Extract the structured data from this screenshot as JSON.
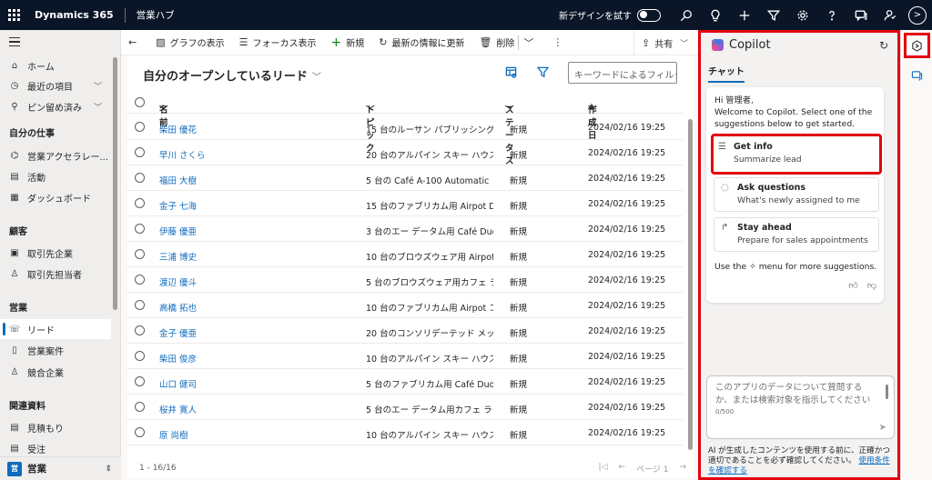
{
  "topbar": {
    "app_title": "Dynamics 365",
    "area": "営業ハブ",
    "new_design": "新デザインを試す",
    "icons": [
      "search-icon",
      "lightbulb-icon",
      "plus-icon",
      "filter-icon",
      "gear-icon",
      "help-icon",
      "chat-icon",
      "people-icon"
    ]
  },
  "sidebar": {
    "home": "ホーム",
    "recent": "最近の項目",
    "pinned": "ピン留め済み",
    "my_work_head": "自分の仕事",
    "my_work": [
      "営業アクセラレー...",
      "活動",
      "ダッシュボード"
    ],
    "customers_head": "顧客",
    "customers": [
      "取引先企業",
      "取引先担当者"
    ],
    "sales_head": "営業",
    "sales": [
      "リード",
      "営業案件",
      "競合企業"
    ],
    "collateral_head": "関連資料",
    "collateral": [
      "見積もり",
      "受注"
    ],
    "area_switch": "営業",
    "area_badge": "営"
  },
  "cmdbar": {
    "show_chart": "グラフの表示",
    "focus_view": "フォーカス表示",
    "new": "新規",
    "refresh": "最新の情報に更新",
    "delete": "削除",
    "share": "共有"
  },
  "view": {
    "title": "自分のオープンしているリード",
    "filter_placeholder": "キーワードによるフィルター",
    "columns": {
      "name": "名前",
      "topic": "トピック",
      "status": "ステータス",
      "created": "作成日"
    },
    "rows": [
      {
        "name": "柴田 優花",
        "topic": "15 台のルーサン パブリッシング用 ...",
        "status": "新規",
        "created": "2024/02/16 19:25"
      },
      {
        "name": "早川 さくら",
        "topic": "20 台のアルパイン スキー ハウス用 ...",
        "status": "新規",
        "created": "2024/02/16 19:25"
      },
      {
        "name": "福田 大樹",
        "topic": "5 台の Café A-100 Automatic",
        "status": "新規",
        "created": "2024/02/16 19:25"
      },
      {
        "name": "金子 七海",
        "topic": "15 台のファブリカム用 Airpot Du...",
        "status": "新規",
        "created": "2024/02/16 19:25"
      },
      {
        "name": "伊藤 優亜",
        "topic": "3 台のエー データム用 Café Duo ...",
        "status": "新規",
        "created": "2024/02/16 19:25"
      },
      {
        "name": "三浦 博史",
        "topic": "10 台のブロウズウェア用 Airpot D...",
        "status": "新規",
        "created": "2024/02/16 19:25"
      },
      {
        "name": "渡辺 優斗",
        "topic": "5 台のブロウズウェア用カフェ ライト ...",
        "status": "新規",
        "created": "2024/02/16 19:25"
      },
      {
        "name": "高橋 拓也",
        "topic": "10 台のファブリカム用 Airpot コー...",
        "status": "新規",
        "created": "2024/02/16 19:25"
      },
      {
        "name": "金子 優亜",
        "topic": "20 台のコンソリデーテッド メッセン...",
        "status": "新規",
        "created": "2024/02/16 19:25"
      },
      {
        "name": "柴田 俊彦",
        "topic": "10 台のアルパイン スキー ハウス用 ...",
        "status": "新規",
        "created": "2024/02/16 19:25"
      },
      {
        "name": "山口 健司",
        "topic": "5 台のファブリカム用 Café Duo エ...",
        "status": "新規",
        "created": "2024/02/16 19:25"
      },
      {
        "name": "桜井 寛人",
        "topic": "5 台のエー データム用カフェ ライト ...",
        "status": "新規",
        "created": "2024/02/16 19:25"
      },
      {
        "name": "原 尚樹",
        "topic": "10 台のアルパイン スキー ハウス用 ...",
        "status": "新規",
        "created": "2024/02/16 19:25"
      }
    ],
    "count": "1 - 16/16",
    "page": "ページ 1"
  },
  "copilot": {
    "title": "Copilot",
    "tab": "チャット",
    "welcome_1": "Hi 管理者,",
    "welcome_2": "Welcome to Copilot. Select one of the suggestions below to get started.",
    "suggestions": [
      {
        "head": "Get info",
        "sub": "Summarize lead"
      },
      {
        "head": "Ask questions",
        "sub": "What's newly assigned to me"
      },
      {
        "head": "Stay ahead",
        "sub": "Prepare for sales appointments"
      }
    ],
    "hint_pre": "Use the",
    "hint_post": "menu for more suggestions.",
    "input_placeholder": "このアプリのデータについて質問するか、または検索対象を指示してください",
    "char_count": "0/500",
    "disclaimer": "AI が生成したコンテンツを使用する前に、正確かつ適切であることを必ず確認してください。",
    "terms_link": "使用条件を確認する"
  },
  "colors": {
    "accent": "#0f6cbd",
    "highlight": "#e3000f",
    "topbar": "#0a1628"
  }
}
